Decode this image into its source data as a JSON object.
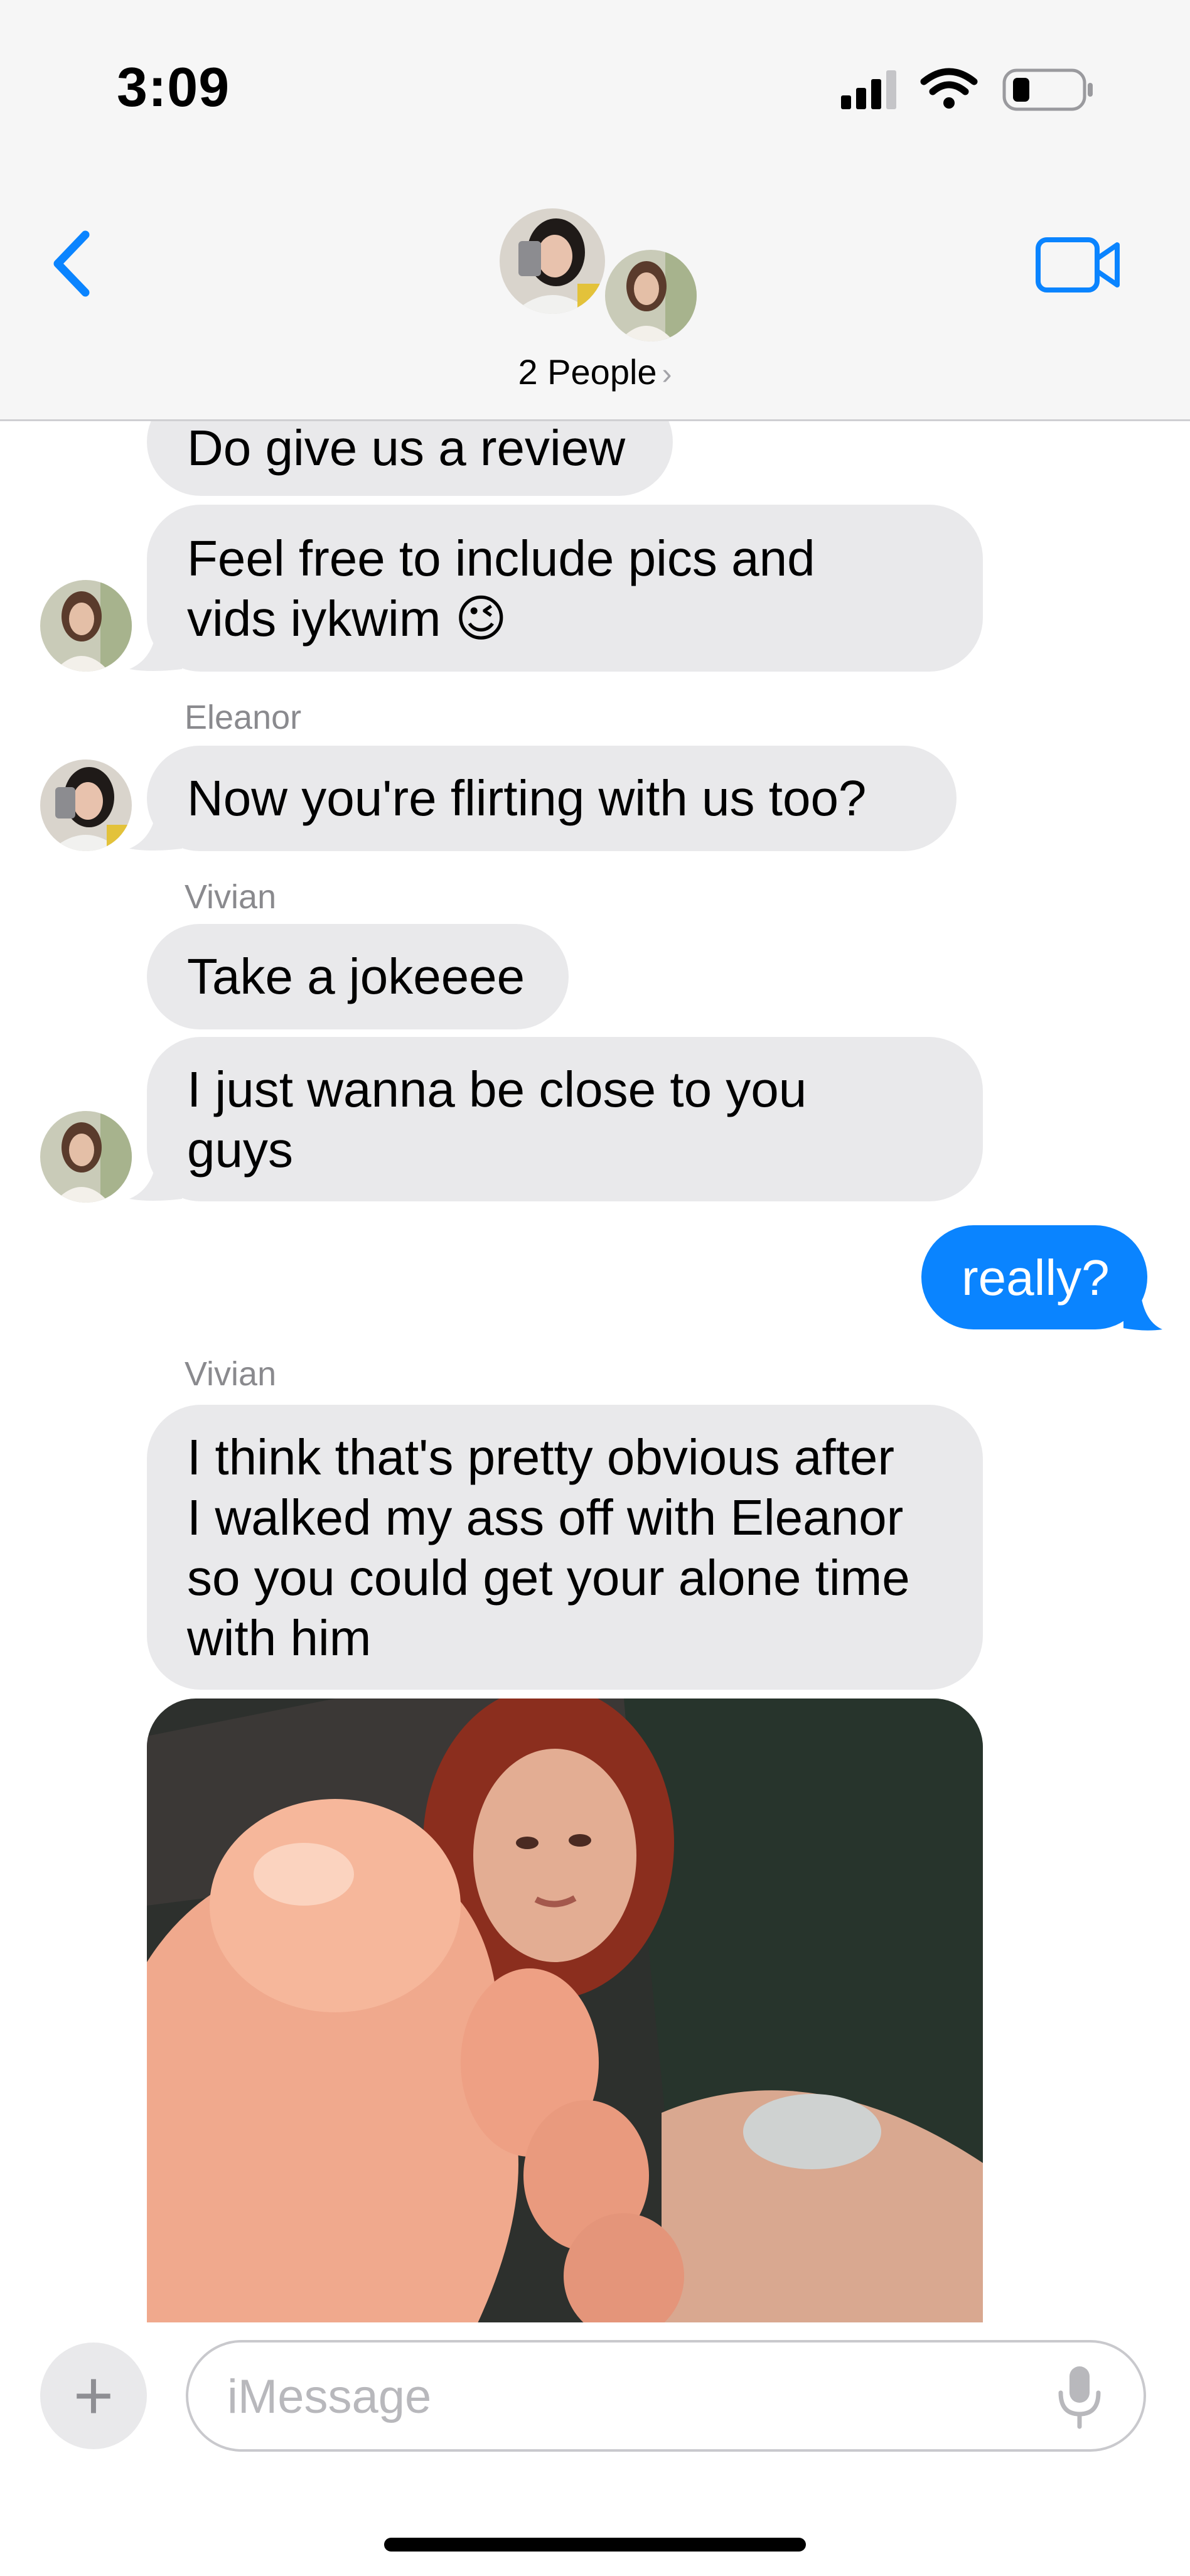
{
  "status_bar": {
    "time": "3:09",
    "icons": [
      "cellular-signal-icon",
      "wifi-icon",
      "battery-icon"
    ]
  },
  "header": {
    "back_icon": "chevron-left-icon",
    "title": "2 People",
    "title_chevron": "›",
    "video_icon": "video-camera-icon",
    "accent_color": "#0a84ff"
  },
  "messages": [
    {
      "direction": "incoming",
      "text": [
        "Do give us a review"
      ]
    },
    {
      "direction": "incoming",
      "text": [
        "Feel free to include pics and",
        "vids iykwim 😉"
      ]
    },
    {
      "direction": "incoming",
      "sender": "Eleanor",
      "text": [
        "Now you're flirting with us too?"
      ]
    },
    {
      "direction": "incoming",
      "sender": "Vivian",
      "text": [
        "Take a jokeeee"
      ]
    },
    {
      "direction": "incoming",
      "text": [
        "I just wanna be close to you",
        "guys"
      ]
    },
    {
      "direction": "outgoing",
      "text": [
        "really?"
      ]
    },
    {
      "direction": "incoming",
      "sender": "Vivian",
      "text": [
        "I think that's pretty obvious after",
        "I walked my ass off with Eleanor",
        "so you could get your alone time",
        "with him"
      ]
    },
    {
      "direction": "incoming",
      "attachment": "photo"
    }
  ],
  "composer": {
    "plus_label": "+",
    "placeholder": "iMessage",
    "mic_icon": "microphone-icon"
  },
  "colors": {
    "incoming_bubble": "#e9e9eb",
    "outgoing_bubble": "#0a84ff",
    "header_bg": "#f6f6f6"
  }
}
